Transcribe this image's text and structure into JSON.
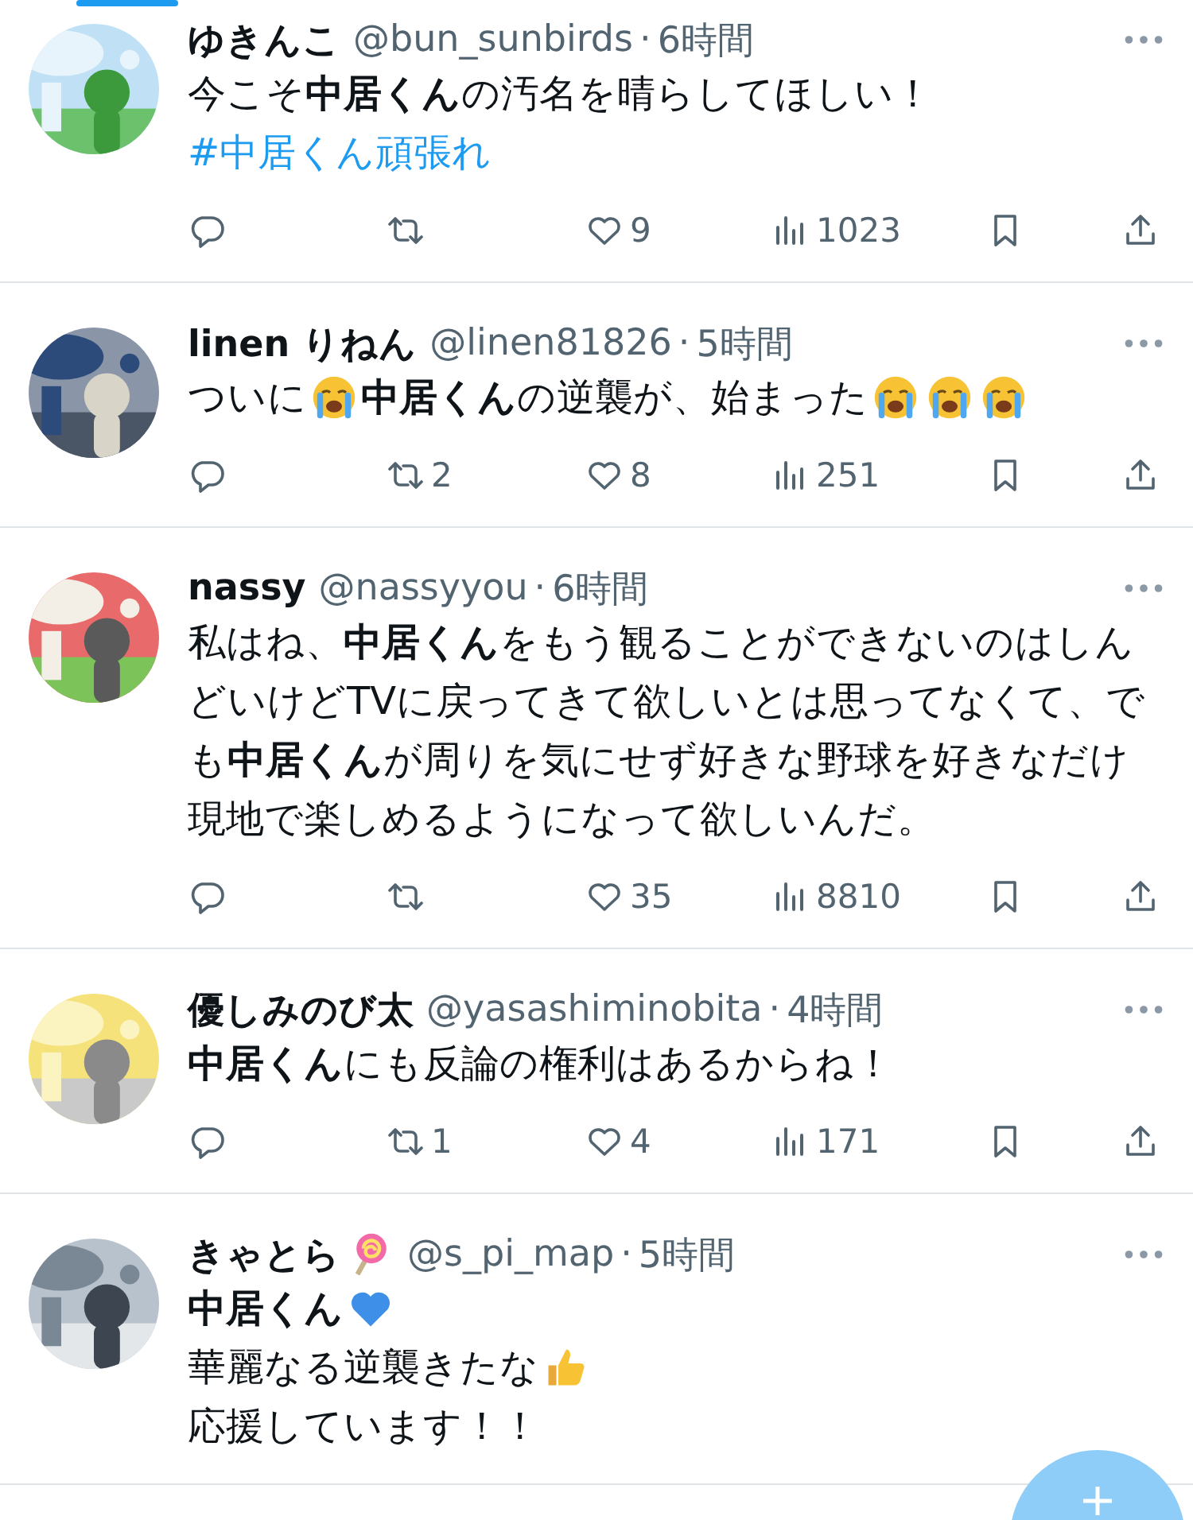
{
  "tweets": [
    {
      "name": [
        {
          "kind": "text",
          "text": "ゆきんこ"
        }
      ],
      "handle": "@bun_sunbirds",
      "dot": "·",
      "time": "6時間",
      "body": [
        [
          {
            "kind": "text",
            "text": "今こそ**中居くん**の汚名を晴らしてほしい！"
          }
        ],
        [
          {
            "kind": "hashtag",
            "text": "#中居くん頑張れ"
          }
        ]
      ],
      "actions": {
        "likes": "9",
        "views": "1023"
      }
    },
    {
      "name": [
        {
          "kind": "text",
          "text": "linen りねん"
        }
      ],
      "handle": "@linen81826",
      "dot": "·",
      "time": "5時間",
      "body": [
        [
          {
            "kind": "text",
            "text": "ついに"
          },
          {
            "kind": "crying"
          },
          {
            "kind": "text",
            "text": "**中居くん**の逆襲が、始まった"
          },
          {
            "kind": "crying"
          },
          {
            "kind": "crying"
          },
          {
            "kind": "crying"
          }
        ]
      ],
      "actions": {
        "retweets": "2",
        "likes": "8",
        "views": "251"
      }
    },
    {
      "name": [
        {
          "kind": "text",
          "text": "nassy"
        }
      ],
      "handle": "@nassyyou",
      "dot": "·",
      "time": "6時間",
      "body": [
        [
          {
            "kind": "text",
            "text": "私はね、**中居くん**をもう観ることができないのはしんどいけどTVに戻ってきて欲しいとは思ってなくて、でも**中居くん**が周りを気にせず好きな野球を好きなだけ現地で楽しめるようになって欲しいんだ。"
          }
        ]
      ],
      "actions": {
        "likes": "35",
        "views": "8810"
      }
    },
    {
      "name": [
        {
          "kind": "text",
          "text": "優しみのび太"
        }
      ],
      "handle": "@yasashiminobita",
      "dot": "·",
      "time": "4時間",
      "body": [
        [
          {
            "kind": "text",
            "text": "**中居くん**にも反論の権利はあるからね！"
          }
        ]
      ],
      "actions": {
        "retweets": "1",
        "likes": "4",
        "views": "171"
      }
    },
    {
      "name": [
        {
          "kind": "text",
          "text": "きゃとら"
        },
        {
          "kind": "lollipop"
        }
      ],
      "handle": "@s_pi_map",
      "dot": "·",
      "time": "5時間",
      "body": [
        [
          {
            "kind": "text",
            "text": "**中居くん**"
          },
          {
            "kind": "blueheart"
          }
        ],
        [
          {
            "kind": "text",
            "text": "華麗なる逆襲きたな"
          },
          {
            "kind": "thumbsup"
          }
        ],
        [
          {
            "kind": "text",
            "text": "応援しています！！"
          }
        ]
      ]
    }
  ]
}
